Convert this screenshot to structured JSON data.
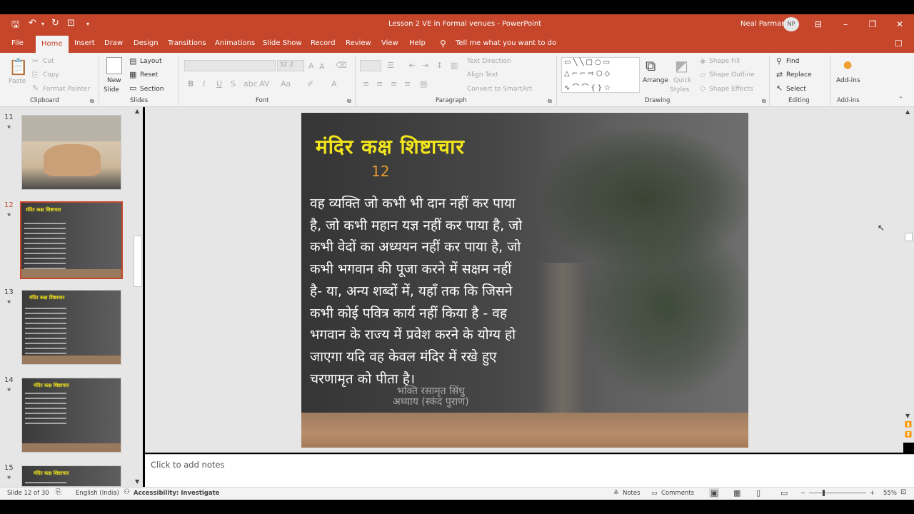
{
  "window": {
    "title": "Lesson 2 VE in Formal venues  -  PowerPoint",
    "user_name": "Neal Parmar",
    "user_initials": "NP"
  },
  "tabs": [
    "File",
    "Home",
    "Insert",
    "Draw",
    "Design",
    "Transitions",
    "Animations",
    "Slide Show",
    "Record",
    "Review",
    "View",
    "Help"
  ],
  "tell_me": "Tell me what you want to do",
  "ribbon": {
    "clipboard": {
      "paste": "Paste",
      "cut": "Cut",
      "copy": "Copy",
      "format_painter": "Format Painter",
      "group": "Clipboard"
    },
    "slides": {
      "new_slide_1": "New",
      "new_slide_2": "Slide",
      "layout": "Layout",
      "reset": "Reset",
      "section": "Section",
      "group": "Slides"
    },
    "font": {
      "size": "32.2",
      "bold": "B",
      "italic": "I",
      "underline": "U",
      "strike": "S",
      "font_color": "A",
      "group": "Font"
    },
    "paragraph": {
      "text_direction": "Text Direction",
      "align_text": "Align Text",
      "convert_smartart": "Convert to SmartArt",
      "group": "Paragraph"
    },
    "drawing": {
      "arrange": "Arrange",
      "quick_styles_1": "Quick",
      "quick_styles_2": "Styles",
      "shape_fill": "Shape Fill",
      "shape_outline": "Shape Outline",
      "shape_effects": "Shape Effects",
      "group": "Drawing"
    },
    "editing": {
      "find": "Find",
      "replace": "Replace",
      "select": "Select",
      "group": "Editing"
    },
    "addins": {
      "label": "Add-ins",
      "group": "Add-ins"
    }
  },
  "thumbnails": [
    {
      "number": "11",
      "title": ""
    },
    {
      "number": "12",
      "title": "मंदिर कक्ष शिष्टाचार"
    },
    {
      "number": "13",
      "title": "मंदिर कक्ष शिष्टाचार"
    },
    {
      "number": "14",
      "title": "मंदिर कक्ष शिष्टाचार"
    },
    {
      "number": "15",
      "title": "मंदिर कक्ष शिष्टाचार"
    }
  ],
  "slide": {
    "title": "मंदिर कक्ष शिष्टाचार",
    "number": "12",
    "body": "वह व्यक्ति जो कभी भी दान नहीं कर पाया है, जो कभी महान यज्ञ नहीं कर पाया है, जो कभी वेदों का अध्ययन नहीं कर पाया है, जो कभी भगवान की पूजा करने में सक्षम नहीं है- या, अन्य शब्दों में, यहाँ तक कि जिसने कभी कोई पवित्र कार्य नहीं किया है - वह भगवान के राज्य में प्रवेश करने के योग्य हो जाएगा यदि वह केवल मंदिर में रखे हुए चरणामृत को पीता है।",
    "overlay_line1": "भक्ति रसामृत सिंधु",
    "overlay_line2": "अध्याय (स्कंद पुराण)"
  },
  "notes_placeholder": "Click to add notes",
  "status": {
    "slide_of": "Slide 12 of 30",
    "language": "English (India)",
    "accessibility": "Accessibility: Investigate",
    "notes": "Notes",
    "comments": "Comments",
    "zoom": "55%"
  },
  "colors": {
    "accent": "#c5462b",
    "title_yellow": "#f3e51b",
    "number_orange": "#e59a2d"
  }
}
